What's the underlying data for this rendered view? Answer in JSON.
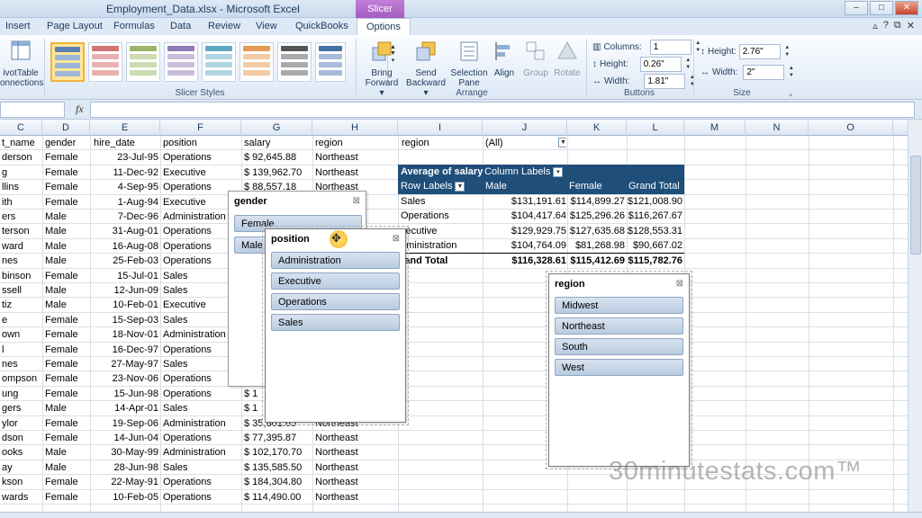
{
  "window": {
    "title": "Employment_Data.xlsx - Microsoft Excel",
    "contextual_tab": "Slicer Tools",
    "min": "–",
    "max": "□",
    "close": "✕"
  },
  "tabs": [
    "Insert",
    "Page Layout",
    "Formulas",
    "Data",
    "Review",
    "View",
    "QuickBooks",
    "Options"
  ],
  "ribbon": {
    "left_button": [
      "ivotTable",
      "onnections"
    ],
    "slicer_styles_label": "Slicer Styles",
    "arrange": {
      "label": "Arrange",
      "bring_forward": [
        "Bring",
        "Forward ▾"
      ],
      "send_backward": [
        "Send",
        "Backward ▾"
      ],
      "selection_pane": [
        "Selection",
        "Pane"
      ],
      "align": "Align",
      "group": "Group",
      "rotate": "Rotate"
    },
    "buttons": {
      "label": "Buttons",
      "columns_label": "Columns:",
      "columns_value": "1",
      "height_label": "Height:",
      "height_value": "0.26\"",
      "width_label": "Width:",
      "width_value": "1.81\""
    },
    "size": {
      "label": "Size",
      "height_label": "Height:",
      "height_value": "2.76\"",
      "width_label": "Width:",
      "width_value": "2\""
    }
  },
  "formula_bar": {
    "fx": "fx",
    "value": ""
  },
  "columns": [
    "C",
    "D",
    "E",
    "F",
    "G",
    "H",
    "I",
    "J",
    "K",
    "L",
    "M",
    "N",
    "O"
  ],
  "rows": [
    [
      "t_name",
      "gender",
      "hire_date",
      "position",
      "salary",
      "region"
    ],
    [
      "derson",
      "Female",
      "23-Jul-95",
      "Operations",
      "$      92,645.88",
      "Northeast"
    ],
    [
      "g",
      "Female",
      "11-Dec-92",
      "Executive",
      "$    139,962.70",
      "Northeast"
    ],
    [
      "llins",
      "Female",
      "4-Sep-95",
      "Operations",
      "$      88,557.18",
      "Northeast"
    ],
    [
      "ith",
      "Female",
      "1-Aug-94",
      "Executive",
      "",
      ""
    ],
    [
      "ers",
      "Male",
      "7-Dec-96",
      "Administration",
      "",
      ""
    ],
    [
      "terson",
      "Male",
      "31-Aug-01",
      "Operations",
      "",
      ""
    ],
    [
      "ward",
      "Male",
      "16-Aug-08",
      "Operations",
      "",
      ""
    ],
    [
      "nes",
      "Male",
      "25-Feb-03",
      "Operations",
      "",
      ""
    ],
    [
      "binson",
      "Female",
      "15-Jul-01",
      "Sales",
      "",
      ""
    ],
    [
      "ssell",
      "Male",
      "12-Jun-09",
      "Sales",
      "",
      ""
    ],
    [
      "tiz",
      "Male",
      "10-Feb-01",
      "Executive",
      "",
      ""
    ],
    [
      "e",
      "Female",
      "15-Sep-03",
      "Sales",
      "",
      ""
    ],
    [
      "own",
      "Female",
      "18-Nov-01",
      "Administration",
      "",
      ""
    ],
    [
      "l",
      "Female",
      "16-Dec-97",
      "Operations",
      "",
      ""
    ],
    [
      "nes",
      "Female",
      "27-May-97",
      "Sales",
      "",
      ""
    ],
    [
      "ompson",
      "Female",
      "23-Nov-06",
      "Operations",
      "",
      ""
    ],
    [
      "ung",
      "Female",
      "15-Jun-98",
      "Operations",
      "$  1",
      ""
    ],
    [
      "gers",
      "Male",
      "14-Apr-01",
      "Sales",
      "$  1",
      ""
    ],
    [
      "ylor",
      "Female",
      "19-Sep-06",
      "Administration",
      "$      35,801.65",
      "Northeast"
    ],
    [
      "dson",
      "Female",
      "14-Jun-04",
      "Operations",
      "$      77,395.87",
      "Northeast"
    ],
    [
      "ooks",
      "Male",
      "30-May-99",
      "Administration",
      "$    102,170.70",
      "Northeast"
    ],
    [
      "ay",
      "Male",
      "28-Jun-98",
      "Sales",
      "$    135,585.50",
      "Northeast"
    ],
    [
      "kson",
      "Female",
      "22-May-91",
      "Operations",
      "$    184,304.80",
      "Northeast"
    ],
    [
      "wards",
      "Female",
      "10-Feb-05",
      "Operations",
      "$    114,490.00",
      "Northeast"
    ]
  ],
  "pivot": {
    "filter_label": "region",
    "filter_value": "(All)",
    "header": [
      "Average of salary",
      "Column Labels"
    ],
    "subheader": [
      "Row Labels",
      "Male",
      "Female",
      "Grand Total"
    ],
    "body": [
      [
        "Sales",
        "$131,191.61",
        "$114,899.27",
        "$121,008.90"
      ],
      [
        "Operations",
        "$104,417.64",
        "$125,296.26",
        "$116,267.67"
      ],
      [
        "xecutive",
        "$129,929.75",
        "$127,635.68",
        "$128,553.31"
      ],
      [
        "dministration",
        "$104,764.09",
        "$81,268.98",
        "$90,667.02"
      ]
    ],
    "total": [
      "rand Total",
      "$116,328.61",
      "$115,412.69",
      "$115,782.76"
    ]
  },
  "slicers": {
    "gender": {
      "title": "gender",
      "items": [
        "Female",
        "Male"
      ]
    },
    "position": {
      "title": "position",
      "items": [
        "Administration",
        "Executive",
        "Operations",
        "Sales"
      ]
    },
    "region": {
      "title": "region",
      "items": [
        "Midwest",
        "Northeast",
        "South",
        "West"
      ]
    }
  },
  "watermark": "30minutestats.com™",
  "colors": {
    "accent": "#1f4e79",
    "slicer_item": "#b9cbe0",
    "tool_tab": "#a35bbf"
  }
}
